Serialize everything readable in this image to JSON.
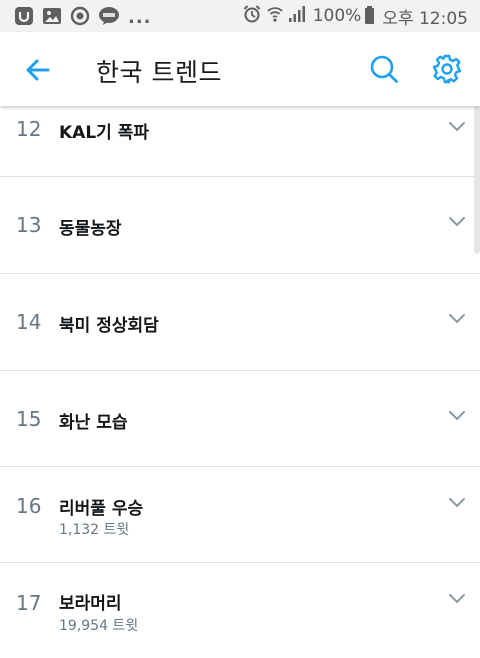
{
  "status_bar": {
    "left_icons": [
      "office-app-icon",
      "gallery-icon",
      "sync-icon",
      "kakaotalk-icon"
    ],
    "overflow": "...",
    "battery_percent": "100%",
    "time": "오후 12:05"
  },
  "app_bar": {
    "title": "한국 트렌드",
    "back_icon": "back-arrow-icon",
    "search_icon": "search-icon",
    "settings_icon": "gear-icon"
  },
  "colors": {
    "accent": "#1da1f2",
    "rank_gray": "#657786",
    "title_text": "#14171a",
    "divider": "#dfe3e7"
  },
  "trends": [
    {
      "rank": "12",
      "title": "KAL기 폭파",
      "tweets": ""
    },
    {
      "rank": "13",
      "title": "동물농장",
      "tweets": ""
    },
    {
      "rank": "14",
      "title": "북미 정상회담",
      "tweets": ""
    },
    {
      "rank": "15",
      "title": "화난 모습",
      "tweets": ""
    },
    {
      "rank": "16",
      "title": "리버풀 우승",
      "tweets": "1,132 트윗"
    },
    {
      "rank": "17",
      "title": "보라머리",
      "tweets": "19,954 트윗"
    }
  ]
}
